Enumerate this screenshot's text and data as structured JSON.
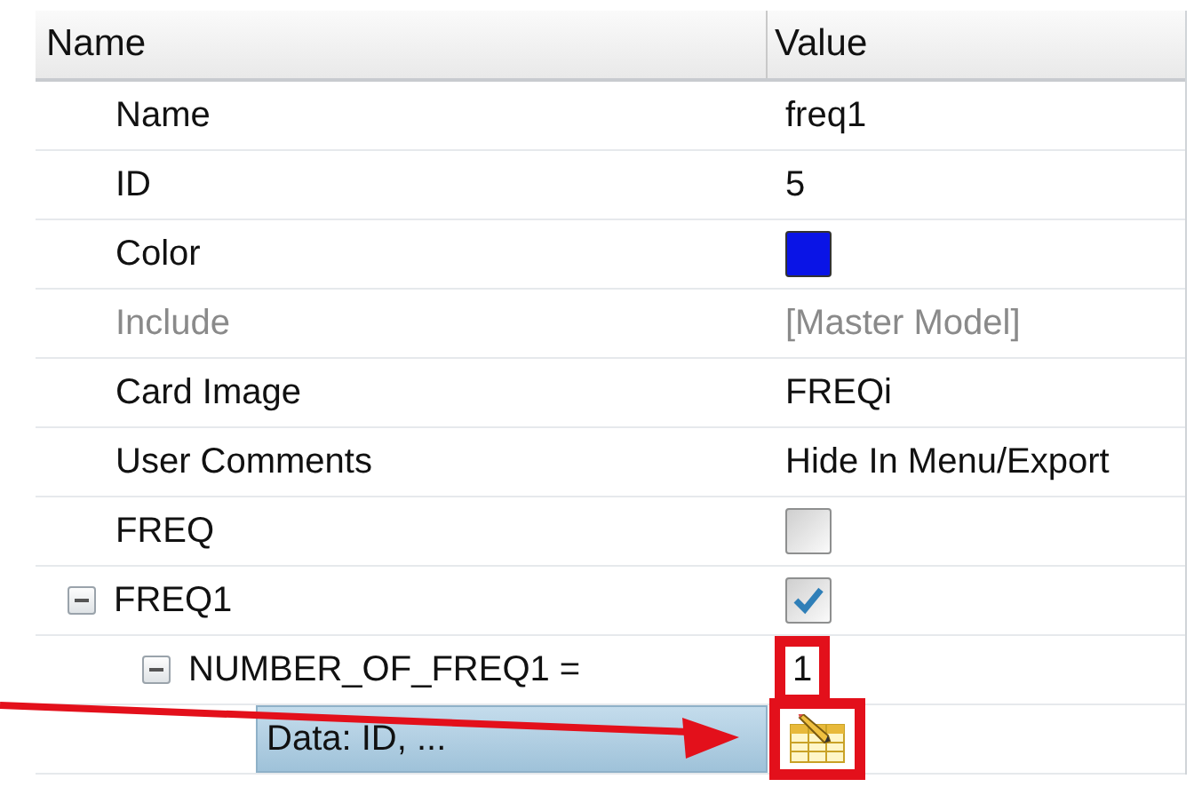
{
  "columns": [
    "Name",
    "Value"
  ],
  "rows": [
    {
      "kind": "text",
      "name": "Name",
      "value": "freq1",
      "disabled": false,
      "selected": false
    },
    {
      "kind": "text",
      "name": "ID",
      "value": "5",
      "disabled": false,
      "selected": false
    },
    {
      "kind": "color",
      "name": "Color",
      "color": "#0a14e6",
      "disabled": false,
      "selected": false
    },
    {
      "kind": "text",
      "name": "Include",
      "value": "[Master Model]",
      "disabled": true,
      "selected": false
    },
    {
      "kind": "text",
      "name": "Card Image",
      "value": "FREQi",
      "disabled": false,
      "selected": false
    },
    {
      "kind": "text",
      "name": "User Comments",
      "value": "Hide In Menu/Export",
      "disabled": false,
      "selected": false
    },
    {
      "kind": "checkbox",
      "name": "FREQ",
      "checked": false,
      "disabled": false,
      "selected": false
    },
    {
      "kind": "checkbox",
      "name": "FREQ1",
      "checked": true,
      "disabled": false,
      "selected": false,
      "expanded": true,
      "children": [
        {
          "kind": "text",
          "name": "NUMBER_OF_FREQ1 =",
          "value": "1",
          "disabled": false,
          "selected": false,
          "annotated": true,
          "expanded": true,
          "children": [
            {
              "kind": "table-button",
              "name": "Data: ID, ...",
              "disabled": false,
              "selected": true,
              "annotated": true
            }
          ]
        }
      ]
    }
  ]
}
